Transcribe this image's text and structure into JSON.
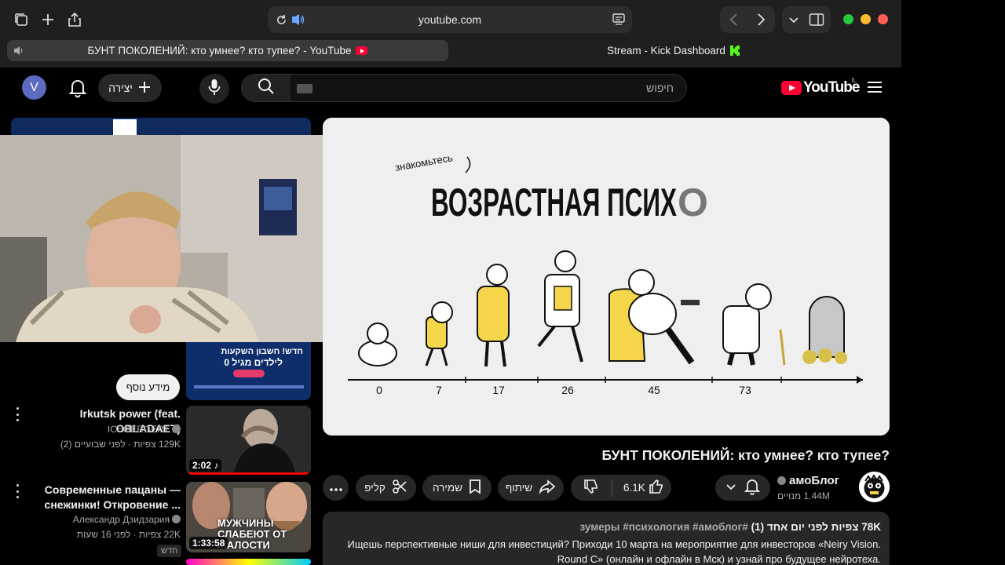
{
  "browser": {
    "url": "youtube.com",
    "tabs": [
      {
        "title": "БУНТ ПОКОЛЕНИЙ: кто умнее? кто тупее? - YouTube",
        "active": true
      },
      {
        "title": "Stream - Kick Dashboard",
        "active": false
      }
    ]
  },
  "header": {
    "avatar_letter": "V",
    "create_label": "יצירה",
    "search_placeholder": "חיפוש",
    "logo_text": "YouTube",
    "logo_region": "IL"
  },
  "sidebar": {
    "more_label": "מידע נוסף",
    "items": [
      {
        "title": "Irkutsk power (feat. OBLADAET)",
        "channel": "ICEGERGERT",
        "meta": "129K צפיות · לפני שבועיים (2)",
        "duration": "2:02"
      },
      {
        "title": "Современные пацаны — снежинки! Откровение ...",
        "channel": "Александр Дзидзария",
        "meta": "22K צפיות · לפני 16 שעות",
        "duration": "1:33:58",
        "badge": "חדש",
        "thumb_text": "МУЖЧИНЫ СЛАБЕЮТ ОТ ЖАЛОСТИ"
      }
    ],
    "ad_thumb": {
      "line1": "חדש! חשבון השקעות",
      "line2": "לילדים מגיל 0"
    }
  },
  "video": {
    "title": "БУНТ ПОКОЛЕНИЙ: кто умнее? кто тупее?",
    "thumbnail": {
      "kicker": "знакомьтесь",
      "headline": "ВОЗРАСТНАЯ ПСИХ",
      "headline_tail": "О",
      "ages": [
        "0",
        "7",
        "17",
        "26",
        "45",
        "73"
      ]
    },
    "channel": {
      "name": "амоБлог",
      "subs": "1.44M מנויים"
    },
    "actions": {
      "likes": "6.1K",
      "share": "שיתוף",
      "save": "שמירה",
      "clip": "קליפ"
    },
    "description": {
      "stats": "78K צפיות  לפני יום אחד (1)",
      "tags": "#зумеры #психология #амоблог",
      "body": "Ищешь перспективные ниши для инвестиций? Приходи 10 марта на мероприятие для инвесторов «Neiry Vision. Round C» (онлайн и офлайн в Мск) и узнай про будущее нейротеха."
    }
  },
  "colors": {
    "accent": "#ff0033",
    "background": "#000000",
    "surface": "#272727",
    "kick_green": "#53fc18"
  }
}
